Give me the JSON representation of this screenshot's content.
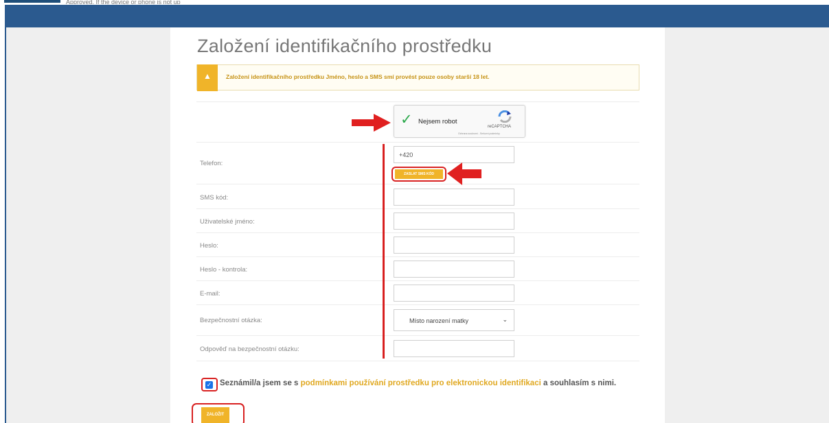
{
  "page": {
    "title": "Založení identifikačního prostředku",
    "top_cutoff_text": "Approved. If the device or phone is not up"
  },
  "alert": {
    "icon": "warning-icon",
    "text": "Založení identifikačního prostředku Jméno, heslo a SMS smí provést pouze osoby starší 18 let."
  },
  "captcha": {
    "label": "Nejsem robot",
    "brand": "reCAPTCHA",
    "terms": "Ochrana soukromí - Smluvní podmínky",
    "checked": true
  },
  "form": {
    "phone_label": "Telefon:",
    "phone_value": "+420",
    "send_sms_label": "ZASLAT SMS KÓD",
    "sms_code_label": "SMS kód:",
    "username_label": "Uživatelské jméno:",
    "password_label": "Heslo:",
    "password_confirm_label": "Heslo - kontrola:",
    "email_label": "E-mail:",
    "security_question_label": "Bezpečnostní otázka:",
    "security_question_value": "Místo narození matky",
    "security_answer_label": "Odpověď na bezpečnostní otázku:"
  },
  "agreement": {
    "prefix": "Seznámil/a jsem se s ",
    "link": "podmínkami používání prostředku pro elektronickou identifikaci",
    "suffix": " a souhlasím s nimi.",
    "checked": true
  },
  "submit_label": "ZALOŽIT",
  "colors": {
    "navbar": "#2b5a8f",
    "accent": "#f0b429",
    "annotation": "#d82020"
  }
}
